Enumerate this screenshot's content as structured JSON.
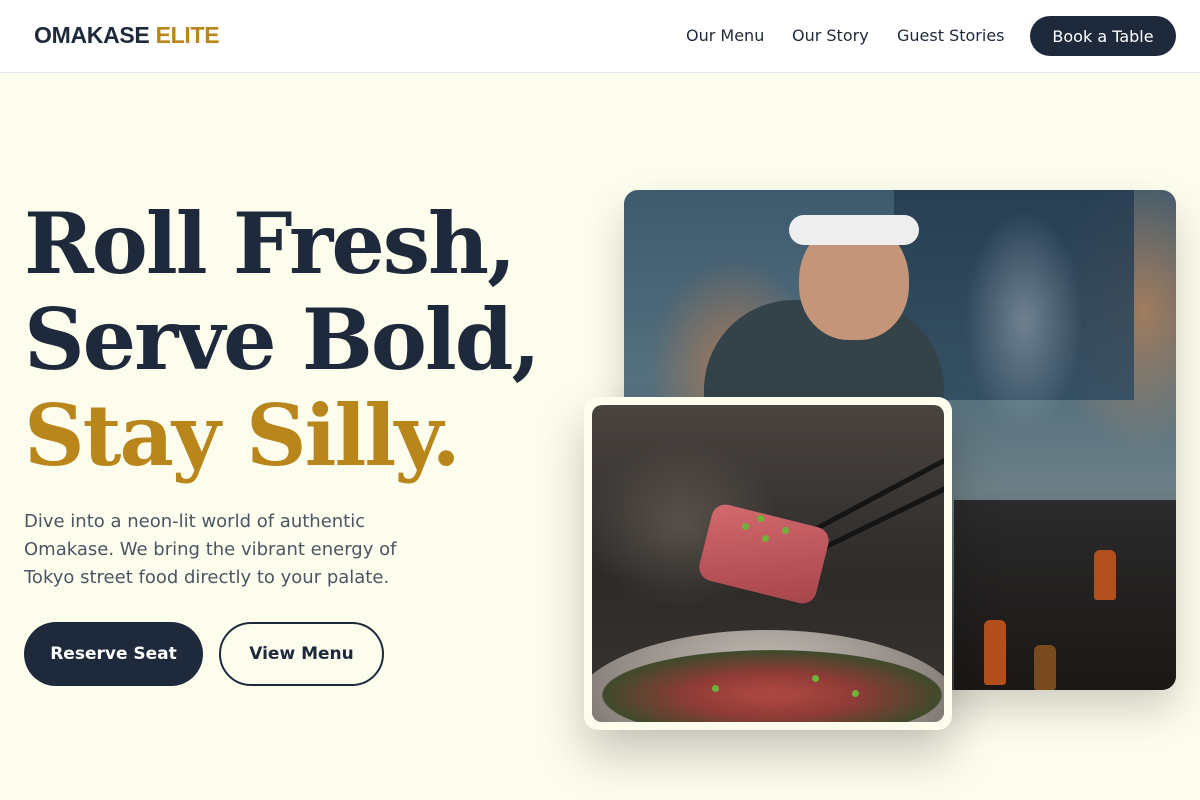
{
  "brand": {
    "name_primary": "OMAKASE",
    "name_accent": "ELITE"
  },
  "nav": {
    "items": [
      {
        "label": "Our Menu"
      },
      {
        "label": "Our Story"
      },
      {
        "label": "Guest Stories"
      }
    ],
    "cta_label": "Book a Table"
  },
  "hero": {
    "headline_line1": "Roll Fresh,",
    "headline_line2": "Serve Bold,",
    "headline_line3": "Stay Silly.",
    "subtitle": "Dive into a neon-lit world of authentic Omakase. We bring the vibrant energy of Tokyo street food directly to your palate.",
    "primary_button": "Reserve Seat",
    "secondary_button": "View Menu"
  },
  "colors": {
    "navy": "#1e293b",
    "gold": "#b8861b",
    "background": "#fdfdee"
  },
  "images": {
    "main": "chef-at-grill-photo",
    "inset": "tuna-sushi-chopsticks-photo"
  }
}
